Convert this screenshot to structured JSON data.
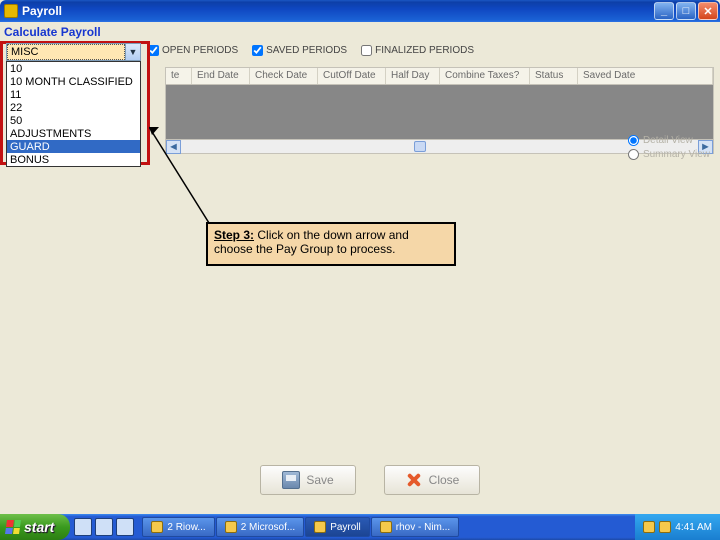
{
  "title": "Payroll",
  "subtitle": "Calculate Payroll",
  "periods": {
    "open": {
      "label": "OPEN PERIODS",
      "checked": true
    },
    "saved": {
      "label": "SAVED PERIODS",
      "checked": true
    },
    "finalized": {
      "label": "FINALIZED PERIODS",
      "checked": false
    }
  },
  "columns": [
    "te",
    "End Date",
    "Check Date",
    "CutOff Date",
    "Half Day",
    "Combine Taxes?",
    "Status",
    "Saved Date"
  ],
  "dropdown": {
    "selected": "MISC",
    "options": [
      "10",
      "10 MONTH CLASSIFIED",
      "11",
      "22",
      "50",
      "ADJUSTMENTS",
      "GUARD",
      "BONUS"
    ]
  },
  "views": {
    "detail": "Detail View",
    "summary": "Summary View"
  },
  "instruction": {
    "step": "Step 3:",
    "text": "Click on the down arrow and choose the Pay Group to process."
  },
  "buttons": {
    "save": "Save",
    "close": "Close"
  },
  "taskbar": {
    "start": "start",
    "items": [
      "2 Riow...",
      "2 Microsof...",
      "Payroll",
      "rhov - Nim..."
    ],
    "clock": "4:41 AM"
  }
}
